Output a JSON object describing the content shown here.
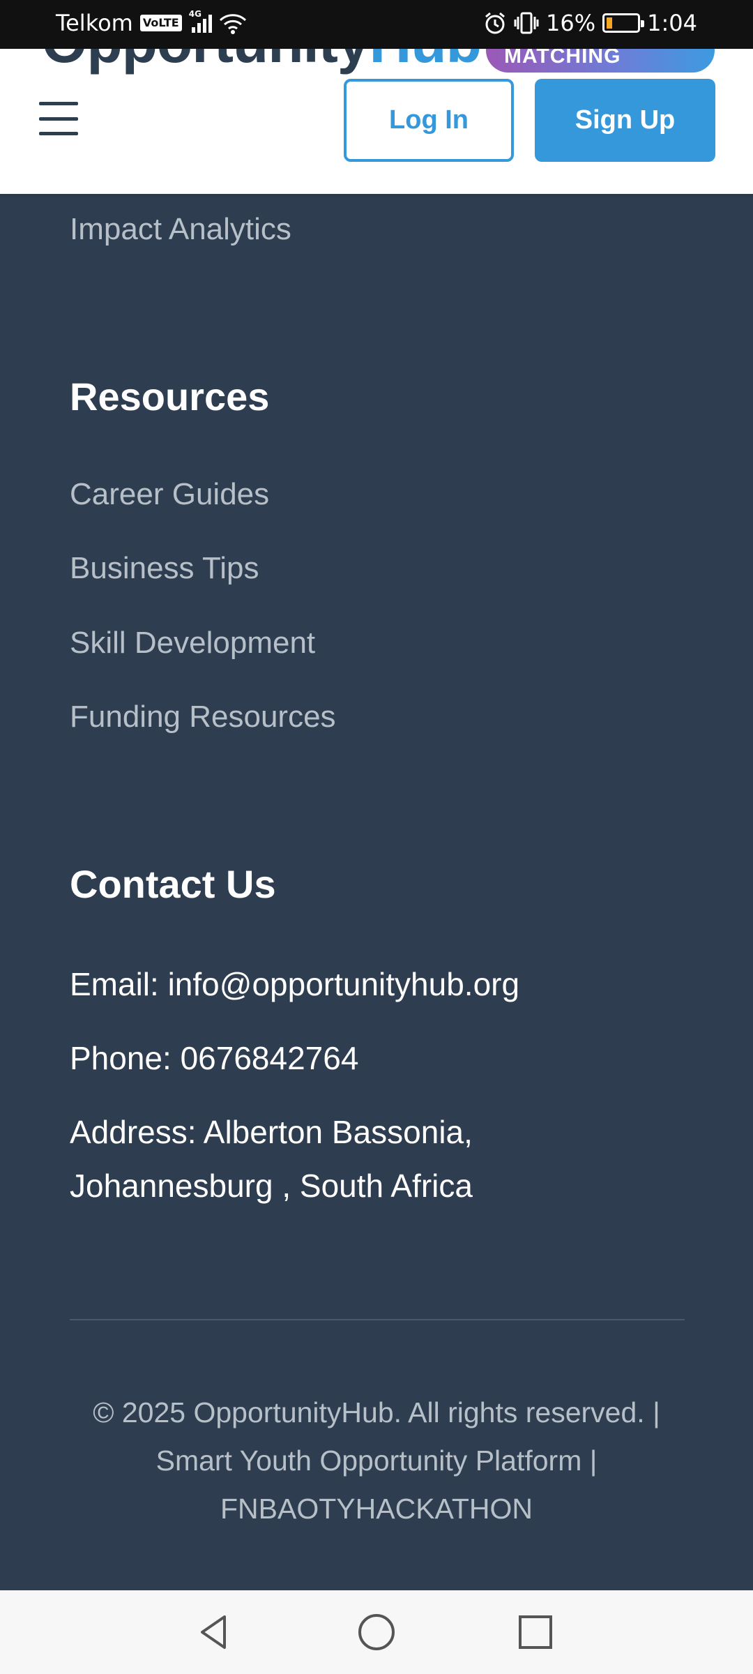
{
  "status_bar": {
    "carrier": "Telkom",
    "volte": "VoLTE",
    "network": "4G",
    "battery_percent": "16%",
    "battery_level": 0.16,
    "time": "1:04",
    "icons": [
      "signal-icon",
      "wifi-icon",
      "alarm-icon",
      "vibrate-icon",
      "battery-icon"
    ]
  },
  "header": {
    "brand_part1": "Opportunity",
    "brand_part2": "Hub",
    "badge": "MATCHING",
    "login_label": "Log In",
    "signup_label": "Sign Up",
    "colors": {
      "primary": "#3498db",
      "dark": "#2c3e50",
      "badge_start": "#9b59b6",
      "badge_end": "#3d9be0"
    }
  },
  "footer": {
    "background": "#2e3d4f",
    "partial_link": "Impact Analytics",
    "resources": {
      "title": "Resources",
      "links": [
        "Career Guides",
        "Business Tips",
        "Skill Development",
        "Funding Resources"
      ]
    },
    "contact": {
      "title": "Contact Us",
      "email": "Email: info@opportunityhub.org",
      "phone": "Phone: 0676842764",
      "address": "Address: Alberton Bassonia, Johannesburg , South Africa"
    },
    "copyright": "© 2025 OpportunityHub. All rights reserved. | Smart Youth Opportunity Platform | FNBAOTYHACKATHON"
  },
  "nav_bar": {
    "icons": [
      "back-icon",
      "home-icon",
      "recents-icon"
    ]
  }
}
